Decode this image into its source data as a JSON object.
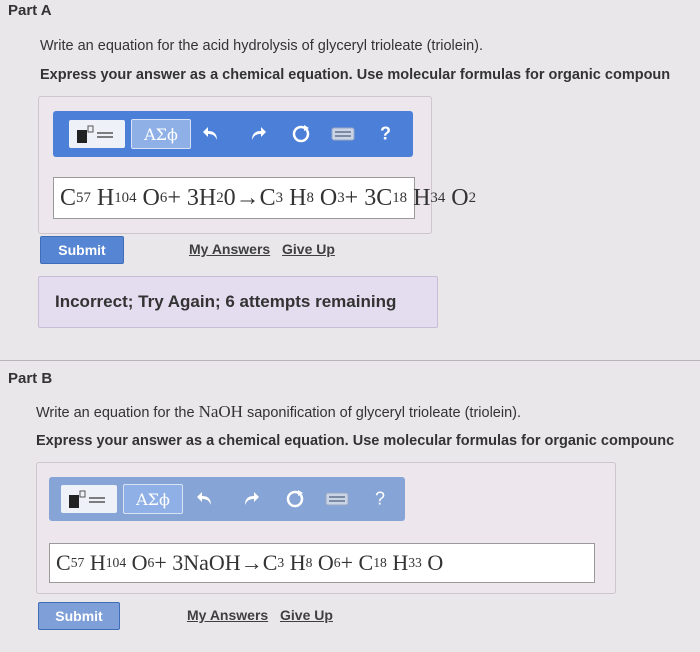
{
  "partA": {
    "title": "Part A",
    "question": "Write an equation for the acid hydrolysis of glyceryl trioleate (triolein).",
    "instruction": "Express your answer as a chemical equation. Use molecular formulas for organic compoun",
    "toolbar": {
      "greek_label": "ΑΣϕ",
      "help_label": "?"
    },
    "answer": {
      "lhs1": "C",
      "lhs1_sub1": "57",
      "lhs1_h": "H",
      "lhs1_sub2": "104",
      "lhs1_o": "O",
      "lhs1_sub3": "6",
      "plus1": " + 3H",
      "water_sub": "2",
      "water_o": "0",
      "arrow": "→",
      "p1": "C",
      "p1_sub1": "3",
      "p1_h": "H",
      "p1_sub2": "8",
      "p1_o": "O",
      "p1_sub3": "3",
      "plus2": " + 3C",
      "p2_sub1": "18",
      "p2_h": "H",
      "p2_sub2": "34",
      "p2_o": "O",
      "p2_sub3": "2"
    },
    "submit_label": "Submit",
    "my_answers_label": "My Answers",
    "give_up_label": "Give Up",
    "feedback": "Incorrect; Try Again; 6 attempts remaining"
  },
  "partB": {
    "title": "Part B",
    "question_pre": "Write an equation for the ",
    "question_naoh": "NaOH",
    "question_post": " saponification of glyceryl trioleate (triolein).",
    "instruction": "Express your answer as a chemical equation. Use molecular formulas for organic compounc",
    "toolbar": {
      "greek_label": "ΑΣϕ",
      "help_label": "?"
    },
    "answer": {
      "lhs1": "C",
      "lhs1_sub1": "57",
      "lhs1_h": "H",
      "lhs1_sub2": "104",
      "lhs1_o": "O",
      "lhs1_sub3": "6",
      "plus1": " + 3NaOH",
      "arrow": "→",
      "p1": "C",
      "p1_sub1": "3",
      "p1_h": "H",
      "p1_sub2": "8",
      "p1_o": "O",
      "p1_sub3": "6",
      "plus2": " + C",
      "p2_sub1": "18",
      "p2_h": "H",
      "p2_sub2": "33",
      "p2_o": "O"
    },
    "submit_label": "Submit",
    "my_answers_label": "My Answers",
    "give_up_label": "Give Up"
  },
  "colors": {
    "toolbar": "#4c7fd8",
    "submit": "#5685d3",
    "feedback_bg": "#e4dcef"
  },
  "icons": [
    "templates-icon",
    "greek-letters-icon",
    "undo-icon",
    "redo-icon",
    "reset-icon",
    "keyboard-icon",
    "help-icon"
  ]
}
